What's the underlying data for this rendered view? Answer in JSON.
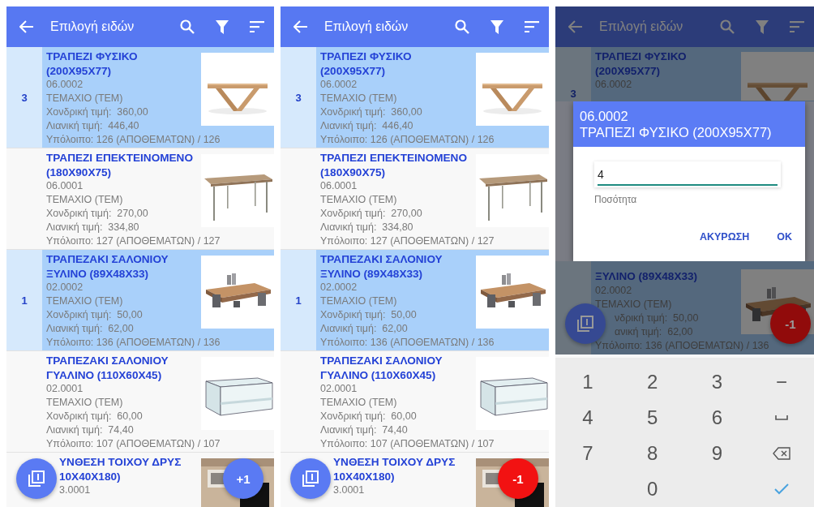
{
  "screens": [
    {
      "header": {
        "title": "Επιλογή ειδών"
      },
      "items": [
        {
          "selected": true,
          "quantity": "3",
          "title": "ΤΡΑΠΕΖΙ ΦΥΣΙΚΟ (200Χ95Χ77)",
          "lines": [
            "06.0002",
            "ΤΕΜΑΧΙΟ (ΤΕΜ)",
            "Χονδρική τιμή:  360,00",
            "Λιανική τιμή:  446,40"
          ],
          "stock": "Υπόλοιπο: 126 (ΑΠΟΘΕΜΑΤΩΝ) / 126"
        },
        {
          "selected": false,
          "title": "ΤΡΑΠΕΖΙ ΕΠΕΚΤΕΙΝΟΜΕΝΟ (180Χ90Χ75)",
          "lines": [
            "06.0001",
            "ΤΕΜΑΧΙΟ (ΤΕΜ)",
            "Χονδρική τιμή:  270,00",
            "Λιανική τιμή:  334,80"
          ],
          "stock": "Υπόλοιπο: 127 (ΑΠΟΘΕΜΑΤΩΝ) / 127"
        },
        {
          "selected": true,
          "quantity": "1",
          "title": "ΤΡΑΠΕΖΑΚΙ ΣΑΛΟΝΙΟΥ ΞΥΛΙΝΟ (89Χ48Χ33)",
          "lines": [
            "02.0002",
            "ΤΕΜΑΧΙΟ (ΤΕΜ)",
            "Χονδρική τιμή:  50,00",
            "Λιανική τιμή:  62,00"
          ],
          "stock": "Υπόλοιπο: 136 (ΑΠΟΘΕΜΑΤΩΝ) / 136"
        },
        {
          "selected": false,
          "title": "ΤΡΑΠΕΖΑΚΙ ΣΑΛΟΝΙΟΥ ΓΥΑΛΙΝΟ (110Χ60Χ45)",
          "lines": [
            "02.0001",
            "ΤΕΜΑΧΙΟ (ΤΕΜ)",
            "Χονδρική τιμή:  60,00",
            "Λιανική τιμή:  74,40"
          ],
          "stock": "Υπόλοιπο: 107 (ΑΠΟΘΕΜΑΤΩΝ) / 107"
        },
        {
          "selected": false,
          "title": "ΥΝΘΕΣΗ ΤΟΙΧΟΥ ΔΡΥΣ 10Χ40Χ180)",
          "lines": [
            "3.0001"
          ]
        }
      ],
      "fab_action": {
        "kind": "increment",
        "label": "+1"
      }
    },
    {
      "header": {
        "title": "Επιλογή ειδών"
      },
      "items": [
        {
          "selected": true,
          "quantity": "3",
          "title": "ΤΡΑΠΕΖΙ ΦΥΣΙΚΟ (200Χ95Χ77)",
          "lines": [
            "06.0002",
            "ΤΕΜΑΧΙΟ (ΤΕΜ)",
            "Χονδρική τιμή:  360,00",
            "Λιανική τιμή:  446,40"
          ],
          "stock": "Υπόλοιπο: 126 (ΑΠΟΘΕΜΑΤΩΝ) / 126"
        },
        {
          "selected": false,
          "title": "ΤΡΑΠΕΖΙ ΕΠΕΚΤΕΙΝΟΜΕΝΟ (180Χ90Χ75)",
          "lines": [
            "06.0001",
            "ΤΕΜΑΧΙΟ (ΤΕΜ)",
            "Χονδρική τιμή:  270,00",
            "Λιανική τιμή:  334,80"
          ],
          "stock": "Υπόλοιπο: 127 (ΑΠΟΘΕΜΑΤΩΝ) / 127"
        },
        {
          "selected": true,
          "quantity": "1",
          "title": "ΤΡΑΠΕΖΑΚΙ ΣΑΛΟΝΙΟΥ ΞΥΛΙΝΟ (89Χ48Χ33)",
          "lines": [
            "02.0002",
            "ΤΕΜΑΧΙΟ (ΤΕΜ)",
            "Χονδρική τιμή:  50,00",
            "Λιανική τιμή:  62,00"
          ],
          "stock": "Υπόλοιπο: 136 (ΑΠΟΘΕΜΑΤΩΝ) / 136"
        },
        {
          "selected": false,
          "title": "ΤΡΑΠΕΖΑΚΙ ΣΑΛΟΝΙΟΥ ΓΥΑΛΙΝΟ (110Χ60Χ45)",
          "lines": [
            "02.0001",
            "ΤΕΜΑΧΙΟ (ΤΕΜ)",
            "Χονδρική τιμή:  60,00",
            "Λιανική τιμή:  74,40"
          ],
          "stock": "Υπόλοιπο: 107 (ΑΠΟΘΕΜΑΤΩΝ) / 107"
        },
        {
          "selected": false,
          "title": "ΥΝΘΕΣΗ ΤΟΙΧΟΥ ΔΡΥΣ 10Χ40Χ180)",
          "lines": [
            "3.0001"
          ]
        }
      ],
      "fab_action": {
        "kind": "decrement",
        "label": "-1"
      }
    },
    {
      "header": {
        "title": "Επιλογή ειδών"
      },
      "items": [
        {
          "selected": true,
          "quantity": "3",
          "title": "ΤΡΑΠΕΖΙ ΦΥΣΙΚΟ (200Χ95Χ77)",
          "lines": [
            "06.0002"
          ]
        },
        {
          "selected": true,
          "title": "ΞΥΛΙΝΟ (89Χ48Χ33)",
          "lines": [
            "02.0002",
            "ΤΕΜΑΧΙΟ (ΤΕΜ)",
            "νδρική τιμή:  50,00",
            "ανική τιμή:  62,00"
          ],
          "stock": "Υπόλοιπο: 136 (ΑΠΟΘΕΜΑΤΩΝ) / 136"
        }
      ],
      "fab_action": {
        "kind": "decrement",
        "label": "-1"
      },
      "dialog": {
        "code": "06.0002",
        "title": "ΤΡΑΠΕΖΙ ΦΥΣΙΚΟ (200Χ95Χ77)",
        "value": "4",
        "field_label": "Ποσότητα",
        "buttons": [
          "ΑΚΥΡΩΣΗ",
          "OK"
        ]
      },
      "keyboard": {
        "keys": [
          {
            "kind": "char",
            "label": "1"
          },
          {
            "kind": "char",
            "label": "2"
          },
          {
            "kind": "char",
            "label": "3"
          },
          {
            "kind": "char",
            "label": "−"
          },
          {
            "kind": "char",
            "label": "4"
          },
          {
            "kind": "char",
            "label": "5"
          },
          {
            "kind": "char",
            "label": "6"
          },
          {
            "kind": "space"
          },
          {
            "kind": "char",
            "label": "7"
          },
          {
            "kind": "char",
            "label": "8"
          },
          {
            "kind": "char",
            "label": "9"
          },
          {
            "kind": "backspace"
          },
          {
            "kind": "char",
            "label": "0"
          },
          {
            "kind": "done"
          }
        ]
      }
    }
  ]
}
